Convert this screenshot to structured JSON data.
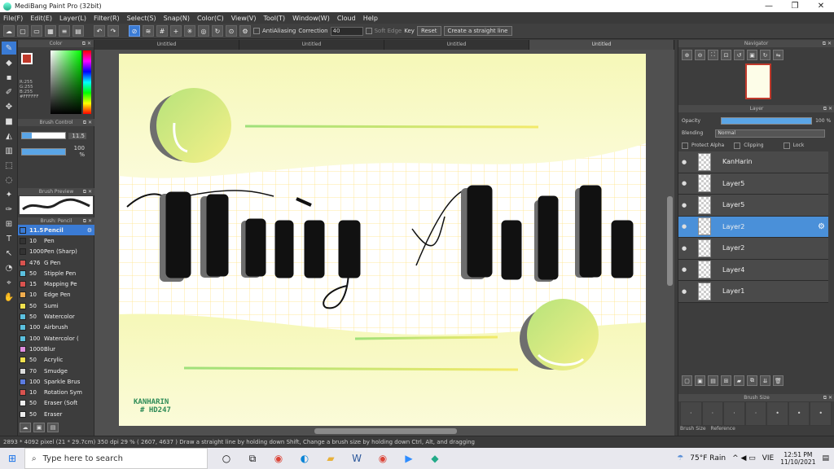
{
  "window": {
    "title": "MediBang Paint Pro (32bit)",
    "minimize": "—",
    "maximize": "❐",
    "close": "✕"
  },
  "menu": [
    "File(F)",
    "Edit(E)",
    "Layer(L)",
    "Filter(R)",
    "Select(S)",
    "Snap(N)",
    "Color(C)",
    "View(V)",
    "Tool(T)",
    "Window(W)",
    "Cloud",
    "Help"
  ],
  "toolbar": {
    "antialiasing": "AntiAliasing",
    "correction_label": "Correction",
    "correction_value": "40",
    "soft_edge": "Soft Edge",
    "key": "Key",
    "reset": "Reset",
    "straight_line": "Create a straight line"
  },
  "panels": {
    "color": "Color",
    "brush_control": "Brush Control",
    "brush_preview": "Brush Preview",
    "brush": "Brush: Pencil",
    "navigator": "Navigator",
    "layer": "Layer",
    "brush_size": "Brush Size"
  },
  "color": {
    "r": "R:255",
    "g": "G:255",
    "b": "B:255",
    "hex": "#FFFFFF",
    "fg": "#c0392b"
  },
  "brush_control": {
    "size": "11.5",
    "opacity": "100 %",
    "opacity_fraction": 1.0
  },
  "brushes": [
    {
      "size": "11.5",
      "name": "Pencil",
      "color": "#3a7bd5",
      "active": true
    },
    {
      "size": "10",
      "name": "Pen",
      "color": "#333333"
    },
    {
      "size": "1000",
      "name": "Pen (Sharp)",
      "color": "#333333"
    },
    {
      "size": "476",
      "name": "G Pen",
      "color": "#d9534f"
    },
    {
      "size": "50",
      "name": "Stipple Pen",
      "color": "#5bc0de"
    },
    {
      "size": "15",
      "name": "Mapping Pe",
      "color": "#d9534f"
    },
    {
      "size": "10",
      "name": "Edge Pen",
      "color": "#f0ad4e"
    },
    {
      "size": "50",
      "name": "Sumi",
      "color": "#f0e04e"
    },
    {
      "size": "50",
      "name": "Watercolor",
      "color": "#5bc0de"
    },
    {
      "size": "100",
      "name": "Airbrush",
      "color": "#5bc0de"
    },
    {
      "size": "100",
      "name": "Watercolor (",
      "color": "#5bc0de"
    },
    {
      "size": "1000",
      "name": "Blur",
      "color": "#e08ee0"
    },
    {
      "size": "50",
      "name": "Acrylic",
      "color": "#f0e04e"
    },
    {
      "size": "70",
      "name": "Smudge",
      "color": "#dddddd"
    },
    {
      "size": "100",
      "name": "Sparkle Brus",
      "color": "#5b7be0"
    },
    {
      "size": "10",
      "name": "Rotation Sym",
      "color": "#d9534f"
    },
    {
      "size": "50",
      "name": "Eraser (Soft",
      "color": "#eeeeee"
    },
    {
      "size": "50",
      "name": "Eraser",
      "color": "#eeeeee"
    }
  ],
  "doc_tabs": [
    "Untitled",
    "Untitled",
    "Untitled",
    "Untitled"
  ],
  "canvas": {
    "watermark_1": "KANHARIN",
    "watermark_2": "# HD247"
  },
  "layer_panel": {
    "opacity_label": "Opacity",
    "opacity_value": "100 %",
    "blending_label": "Blending",
    "blending_value": "Normal",
    "protect_alpha": "Protect Alpha",
    "clipping": "Clipping",
    "lock": "Lock"
  },
  "layers": [
    {
      "name": "KanHarin",
      "active": false
    },
    {
      "name": "Layer5",
      "active": false
    },
    {
      "name": "Layer5",
      "active": false
    },
    {
      "name": "Layer2",
      "active": true
    },
    {
      "name": "Layer2",
      "active": false
    },
    {
      "name": "Layer4",
      "active": false
    },
    {
      "name": "Layer1",
      "active": false
    }
  ],
  "right_tabs": [
    "Brush Size",
    "Reference"
  ],
  "status": "2893 * 4092 pixel   (21 * 29.7cm)   350 dpi   29 %   ( 2607, 4637 )   Draw a straight line by holding down Shift, Change a brush size by holding down Ctrl, Alt, and dragging",
  "taskbar": {
    "search_placeholder": "Type here to search",
    "weather": "75°F  Rain",
    "lang": "VIE",
    "time": "12:51 PM",
    "date": "11/10/2021"
  }
}
